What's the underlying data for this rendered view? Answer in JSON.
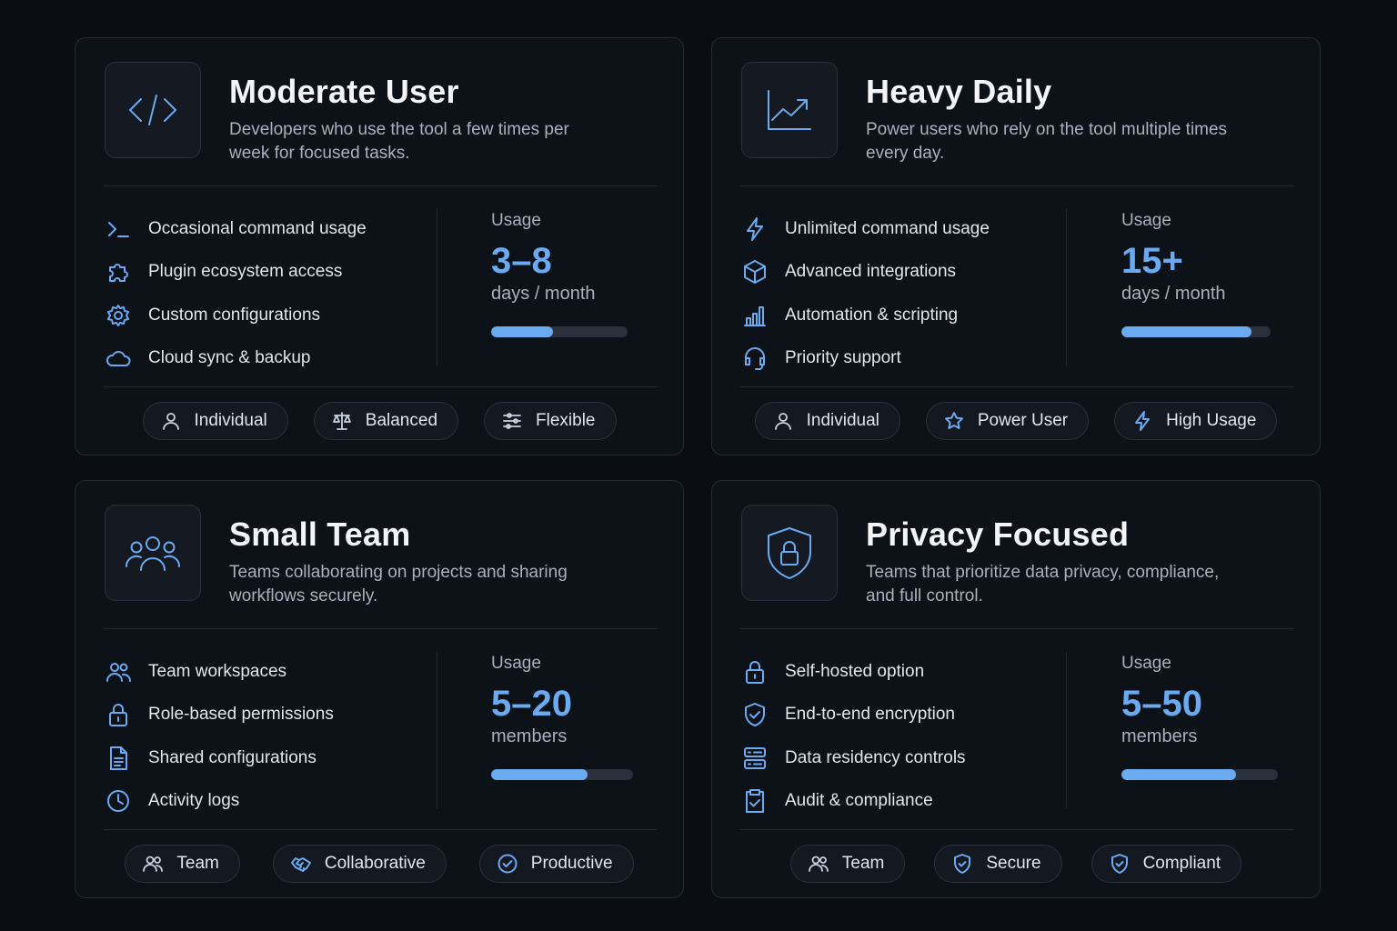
{
  "colors": {
    "accent": "#6aaaf0",
    "background": "#0a0d13",
    "card": "#0d1118",
    "border": "#262c37"
  },
  "cards": [
    {
      "icon": "code-icon",
      "title": "Moderate User",
      "description": "Developers who use the tool a few times per week for focused tasks.",
      "features": [
        {
          "icon": "terminal-icon",
          "label": "Occasional command usage"
        },
        {
          "icon": "puzzle-icon",
          "label": "Plugin ecosystem access"
        },
        {
          "icon": "gear-icon",
          "label": "Custom configurations"
        },
        {
          "icon": "cloud-icon",
          "label": "Cloud sync & backup"
        }
      ],
      "usage": {
        "label": "Usage",
        "value": "3–8",
        "unit": "days / month",
        "fill_fraction": 0.45
      },
      "tags": [
        {
          "icon": "user-icon",
          "label": "Individual"
        },
        {
          "icon": "scale-icon",
          "label": "Balanced"
        },
        {
          "icon": "sliders-icon",
          "label": "Flexible"
        }
      ]
    },
    {
      "icon": "chart-trend-icon",
      "title": "Heavy Daily",
      "description": "Power users who rely on the tool multiple times every day.",
      "features": [
        {
          "icon": "lightning-icon",
          "label": "Unlimited command usage"
        },
        {
          "icon": "cube-icon",
          "label": "Advanced integrations"
        },
        {
          "icon": "bar-chart-icon",
          "label": "Automation & scripting"
        },
        {
          "icon": "headset-icon",
          "label": "Priority support"
        }
      ],
      "usage": {
        "label": "Usage",
        "value": "15+",
        "unit": "days / month",
        "fill_fraction": 0.87
      },
      "tags": [
        {
          "icon": "user-icon",
          "label": "Individual"
        },
        {
          "icon": "star-icon",
          "label": "Power User"
        },
        {
          "icon": "lightning-icon",
          "label": "High Usage"
        }
      ]
    },
    {
      "icon": "team-icon",
      "title": "Small Team",
      "description": "Teams collaborating on projects and sharing workflows securely.",
      "features": [
        {
          "icon": "users-icon",
          "label": "Team workspaces"
        },
        {
          "icon": "lock-icon",
          "label": "Role-based permissions"
        },
        {
          "icon": "document-icon",
          "label": "Shared configurations"
        },
        {
          "icon": "clock-icon",
          "label": "Activity logs"
        }
      ],
      "usage": {
        "label": "Usage",
        "value": "5–20",
        "unit": "members",
        "fill_fraction": 0.68
      },
      "tags": [
        {
          "icon": "users-icon",
          "label": "Team"
        },
        {
          "icon": "handshake-icon",
          "label": "Collaborative"
        },
        {
          "icon": "check-circle-icon",
          "label": "Productive"
        }
      ]
    },
    {
      "icon": "shield-lock-icon",
      "title": "Privacy Focused",
      "description": "Teams that prioritize data privacy, compliance, and full control.",
      "features": [
        {
          "icon": "lock-icon",
          "label": "Self-hosted option"
        },
        {
          "icon": "shield-check-icon",
          "label": "End-to-end encryption"
        },
        {
          "icon": "server-icon",
          "label": "Data residency controls"
        },
        {
          "icon": "clipboard-check-icon",
          "label": "Audit & compliance"
        }
      ],
      "usage": {
        "label": "Usage",
        "value": "5–50",
        "unit": "members",
        "fill_fraction": 0.73
      },
      "tags": [
        {
          "icon": "users-icon",
          "label": "Team"
        },
        {
          "icon": "shield-check-icon",
          "label": "Secure"
        },
        {
          "icon": "shield-check-icon",
          "label": "Compliant"
        }
      ]
    }
  ]
}
